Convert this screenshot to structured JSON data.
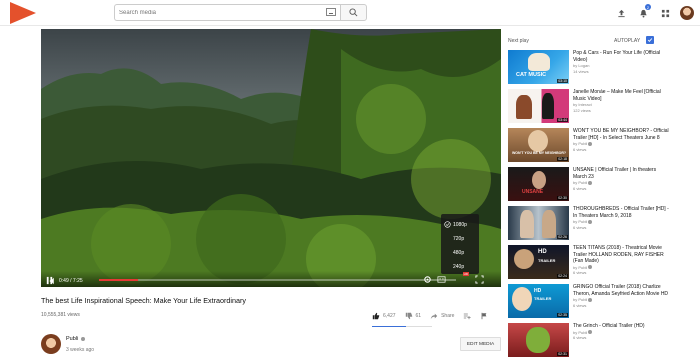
{
  "header": {
    "search_placeholder": "Search media",
    "notification_count": "2"
  },
  "player": {
    "time": "0:49 / 7:25",
    "progress_fraction": 0.11,
    "quality_options": [
      "1080p",
      "720p",
      "480p",
      "240p"
    ],
    "selected_quality": "1080p",
    "hd_badge": "HD"
  },
  "video": {
    "title": "The best Life Inspirational Speech: Make Your Life Extraordinary",
    "views": "10,555,381 views",
    "likes": "6,427",
    "dislikes": "61",
    "share_label": "Share",
    "uploader": "Publi",
    "uploaded": "3 weeks ago",
    "edit_label": "EDIT MEDIA"
  },
  "sidebar": {
    "next_label": "Next play",
    "autoplay_label": "AUTOPLAY",
    "items": [
      {
        "title": "Pop & Cars - Run For Your Life (Official Video)",
        "channel": "by Logan",
        "views": "14 views",
        "duration": "03:10"
      },
      {
        "title": "Janelle Monáe – Make Me Feel [Official Music Video]",
        "channel": "by Interact",
        "views": "122 views",
        "duration": "03:44"
      },
      {
        "title": "WON'T YOU BE MY NEIGHBOR? - Official Trailer [HD] - In Select Theaters June 8",
        "channel": "by Publi",
        "views": "6 views",
        "duration": "02:18"
      },
      {
        "title": "UNSANE | Official Trailer | In theaters March 23",
        "channel": "by Publi",
        "views": "6 views",
        "duration": "02:30"
      },
      {
        "title": "THOROUGHBREDS - Official Trailer [HD] - In Theaters March 9, 2018",
        "channel": "by Publi",
        "views": "6 views",
        "duration": "02:26"
      },
      {
        "title": "TEEN TITANS (2018) - Theatrical Movie Trailer HOLLAND RODEN, RAY FISHER (Fan Made)",
        "channel": "by Publi",
        "views": "6 views",
        "duration": "02:24"
      },
      {
        "title": "GRINGO Official Trailer (2018) Charlize Theron, Amanda Seyfried Action Movie HD",
        "channel": "by Publi",
        "views": "6 views",
        "duration": "02:35"
      },
      {
        "title": "The Grinch - Official Trailer (HD)",
        "channel": "by Publi",
        "views": "6 views",
        "duration": "02:31"
      }
    ]
  }
}
